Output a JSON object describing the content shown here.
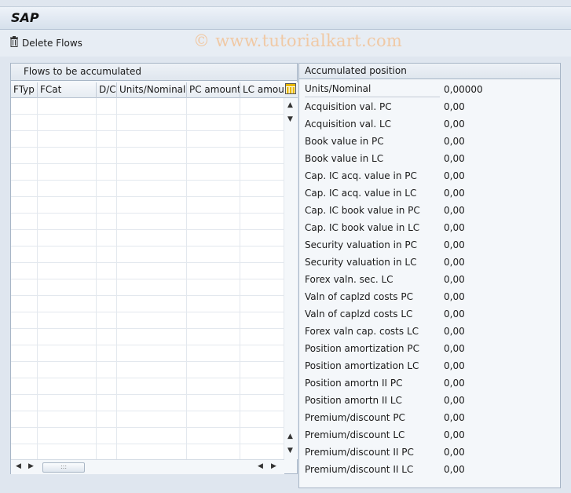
{
  "title": "SAP",
  "watermark": "© www.tutorialkart.com",
  "toolbar": {
    "delete_flows_label": "Delete Flows"
  },
  "left_panel": {
    "title": "Flows to be accumulated",
    "columns": [
      "FTyp",
      "FCat",
      "D/C",
      "Units/Nominal",
      "PC amount",
      "LC amour"
    ]
  },
  "right_panel": {
    "title": "Accumulated position",
    "rows": [
      {
        "label": "Units/Nominal",
        "value": "0,00000"
      },
      {
        "label": "Acquisition val. PC",
        "value": "0,00"
      },
      {
        "label": "Acquisition val. LC",
        "value": "0,00"
      },
      {
        "label": "Book value in PC",
        "value": "0,00"
      },
      {
        "label": "Book value in LC",
        "value": "0,00"
      },
      {
        "label": "Cap. IC acq. value in PC",
        "value": "0,00"
      },
      {
        "label": "Cap. IC acq. value in LC",
        "value": "0,00"
      },
      {
        "label": "Cap. IC book value in PC",
        "value": "0,00"
      },
      {
        "label": "Cap. IC book value in LC",
        "value": "0,00"
      },
      {
        "label": "Security valuation in PC",
        "value": "0,00"
      },
      {
        "label": "Security valuation in LC",
        "value": "0,00"
      },
      {
        "label": "Forex valn. sec. LC",
        "value": "0,00"
      },
      {
        "label": "Valn of caplzd costs PC",
        "value": "0,00"
      },
      {
        "label": "Valn of caplzd costs LC",
        "value": "0,00"
      },
      {
        "label": "Forex valn cap. costs LC",
        "value": "0,00"
      },
      {
        "label": "Position amortization PC",
        "value": "0,00"
      },
      {
        "label": "Position amortization LC",
        "value": "0,00"
      },
      {
        "label": "Position amortn II PC",
        "value": "0,00"
      },
      {
        "label": "Position amortn II LC",
        "value": "0,00"
      },
      {
        "label": "Premium/discount PC",
        "value": "0,00"
      },
      {
        "label": "Premium/discount LC",
        "value": "0,00"
      },
      {
        "label": "Premium/discount II PC",
        "value": "0,00"
      },
      {
        "label": "Premium/discount II LC",
        "value": "0,00"
      }
    ]
  },
  "icons": {
    "delete": "trash-icon",
    "column_config": "column-layout-icon",
    "scroll_up": "arrow-up-icon",
    "scroll_down": "arrow-down-icon",
    "scroll_left": "arrow-left-icon",
    "scroll_right": "arrow-right-icon"
  },
  "colors": {
    "accent": "#dfe6ef",
    "watermark": "#f0c9a5",
    "config_icon": "#e8b800"
  }
}
